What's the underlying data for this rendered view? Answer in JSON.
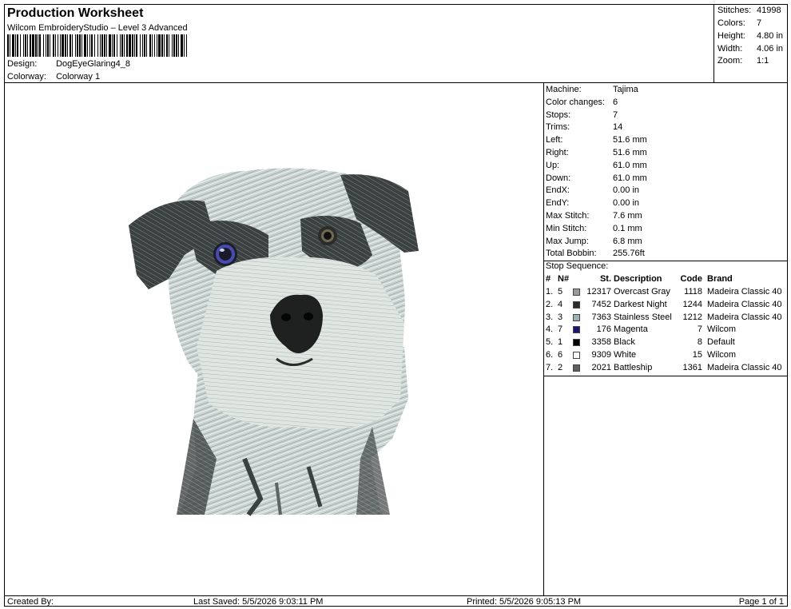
{
  "header": {
    "title": "Production Worksheet",
    "subtitle": "Wilcom EmbroideryStudio – Level 3 Advanced",
    "design_label": "Design:",
    "design_value": "DogEyeGlaring4_8",
    "colorway_label": "Colorway:",
    "colorway_value": "Colorway 1"
  },
  "stats": [
    {
      "label": "Stitches:",
      "value": "41998"
    },
    {
      "label": "Colors:",
      "value": "7"
    },
    {
      "label": "Height:",
      "value": "4.80 in"
    },
    {
      "label": "Width:",
      "value": "4.06 in"
    },
    {
      "label": "Zoom:",
      "value": "1:1"
    }
  ],
  "machine_info": [
    {
      "label": "Machine:",
      "value": "Tajima"
    },
    {
      "label": "Color changes:",
      "value": "6"
    },
    {
      "label": "Stops:",
      "value": "7"
    },
    {
      "label": "Trims:",
      "value": "14"
    },
    {
      "label": "Left:",
      "value": "51.6 mm"
    },
    {
      "label": "Right:",
      "value": "51.6 mm"
    },
    {
      "label": "Up:",
      "value": "61.0 mm"
    },
    {
      "label": "Down:",
      "value": "61.0 mm"
    },
    {
      "label": "EndX:",
      "value": "0.00 in"
    },
    {
      "label": "EndY:",
      "value": "0.00 in"
    },
    {
      "label": "Max Stitch:",
      "value": "7.6 mm"
    },
    {
      "label": "Min Stitch:",
      "value": "0.1 mm"
    },
    {
      "label": "Max Jump:",
      "value": "6.8 mm"
    },
    {
      "label": "Total Bobbin:",
      "value": "255.76ft"
    }
  ],
  "stop_sequence": {
    "title": "Stop Sequence:",
    "headers": {
      "num": "#",
      "n": "N#",
      "st": "St.",
      "desc": "Description",
      "code": "Code",
      "brand": "Brand"
    },
    "rows": [
      {
        "num": "1.",
        "n": "5",
        "st": "12317",
        "desc": "Overcast Gray",
        "code": "1118",
        "brand": "Madeira Classic 40",
        "color": "#9a9a9a"
      },
      {
        "num": "2.",
        "n": "4",
        "st": "7452",
        "desc": "Darkest Night",
        "code": "1244",
        "brand": "Madeira Classic 40",
        "color": "#2b2b2b"
      },
      {
        "num": "3.",
        "n": "3",
        "st": "7363",
        "desc": "Stainless Steel",
        "code": "1212",
        "brand": "Madeira Classic 40",
        "color": "#9fb3b6"
      },
      {
        "num": "4.",
        "n": "7",
        "st": "176",
        "desc": "Magenta",
        "code": "7",
        "brand": "Wilcom",
        "color": "#1a1570"
      },
      {
        "num": "5.",
        "n": "1",
        "st": "3358",
        "desc": "Black",
        "code": "8",
        "brand": "Default",
        "color": "#000000"
      },
      {
        "num": "6.",
        "n": "6",
        "st": "9309",
        "desc": "White",
        "code": "15",
        "brand": "Wilcom",
        "color": "#ffffff"
      },
      {
        "num": "7.",
        "n": "2",
        "st": "2021",
        "desc": "Battleship",
        "code": "1361",
        "brand": "Madeira Classic 40",
        "color": "#5e5e5e"
      }
    ]
  },
  "footer": {
    "created_by": "Created By:",
    "last_saved": "Last Saved: 5/5/2026 9:03:11 PM",
    "printed": "Printed: 5/5/2026 9:05:13 PM",
    "page": "Page 1 of 1"
  }
}
